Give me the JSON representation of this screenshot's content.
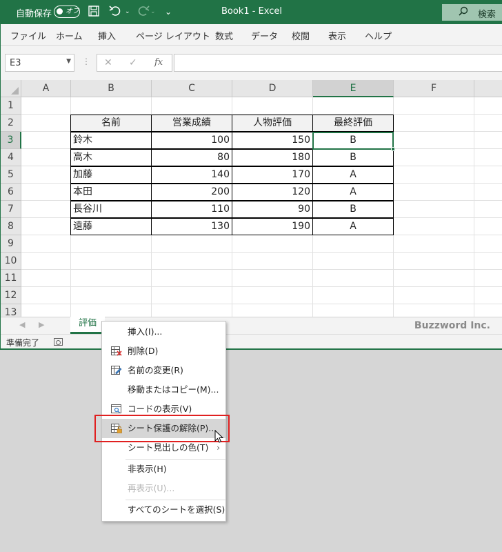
{
  "titlebar": {
    "autosave_label": "自動保存",
    "autosave_state": "オフ",
    "title": "Book1  -  Excel",
    "search_label": "検索",
    "quick_access_more": "⌄"
  },
  "ribbon": {
    "tabs": [
      "ファイル",
      "ホーム",
      "挿入",
      "ページ レイアウト",
      "数式",
      "データ",
      "校閲",
      "表示",
      "ヘルプ"
    ]
  },
  "formula_bar": {
    "name_box": "E3",
    "cancel_symbol": "✕",
    "enter_symbol": "✓",
    "fx_symbol": "fx",
    "formula": ""
  },
  "grid": {
    "columns": [
      "A",
      "B",
      "C",
      "D",
      "E",
      "F"
    ],
    "rows": [
      "1",
      "2",
      "3",
      "4",
      "5",
      "6",
      "7",
      "8",
      "9",
      "10",
      "11",
      "12",
      "13"
    ],
    "selected_cell": "E3",
    "table_headers": [
      "名前",
      "営業成績",
      "人物評価",
      "最終評価"
    ],
    "table_rows": [
      [
        "鈴木",
        "100",
        "150",
        "B"
      ],
      [
        "高木",
        "80",
        "180",
        "B"
      ],
      [
        "加藤",
        "140",
        "170",
        "A"
      ],
      [
        "本田",
        "200",
        "120",
        "A"
      ],
      [
        "長谷川",
        "110",
        "90",
        "B"
      ],
      [
        "遠藤",
        "130",
        "190",
        "A"
      ]
    ]
  },
  "sheet_tabs": {
    "active_tab": "評価",
    "watermark": "Buzzword Inc."
  },
  "statusbar": {
    "status": "準備完了"
  },
  "context_menu": {
    "items": [
      {
        "label": "挿入(I)...",
        "icon": "",
        "enabled": true
      },
      {
        "label": "削除(D)",
        "icon": "delete-sheet-icon",
        "enabled": true
      },
      {
        "label": "名前の変更(R)",
        "icon": "rename-sheet-icon",
        "enabled": true
      },
      {
        "label": "移動またはコピー(M)...",
        "icon": "",
        "enabled": true
      },
      {
        "label": "コードの表示(V)",
        "icon": "view-code-icon",
        "enabled": true
      },
      {
        "label": "シート保護の解除(P)...",
        "icon": "unprotect-sheet-icon",
        "enabled": true,
        "highlighted": true
      },
      {
        "label": "シート見出しの色(T)",
        "icon": "",
        "enabled": true,
        "submenu": true
      },
      {
        "label": "非表示(H)",
        "icon": "",
        "enabled": true
      },
      {
        "label": "再表示(U)...",
        "icon": "",
        "enabled": false
      },
      {
        "label": "すべてのシートを選択(S)",
        "icon": "",
        "enabled": true
      }
    ]
  },
  "colors": {
    "excel_green": "#217346",
    "highlight_box": "#e02020"
  }
}
